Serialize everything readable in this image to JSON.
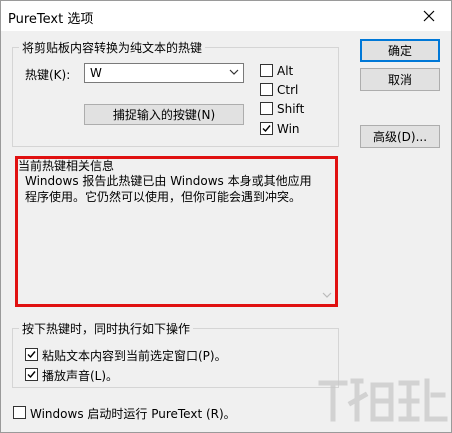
{
  "window": {
    "title": "PureText 选项"
  },
  "hotkey_group": {
    "title": "将剪贴板内容转换为纯文本的热键",
    "hotkey_label": "热键(K):",
    "hotkey_value": "W",
    "capture_button": "捕捉输入的按键(N)",
    "modifiers": [
      {
        "label": "Alt",
        "checked": false
      },
      {
        "label": "Ctrl",
        "checked": false
      },
      {
        "label": "Shift",
        "checked": false
      },
      {
        "label": "Win",
        "checked": true
      }
    ]
  },
  "buttons": {
    "ok": "确定",
    "cancel": "取消",
    "advanced": "高级(D)..."
  },
  "info_group": {
    "title": "当前热键相关信息",
    "text": "Windows 报告此热键已由 Windows 本身或其他应用程序使用。它仍然可以使用，但你可能会遇到冲突。"
  },
  "action_group": {
    "title": "按下热键时，同时执行如下操作",
    "paste": {
      "label": "粘贴文本内容到当前选定窗口(P)。",
      "checked": true
    },
    "sound": {
      "label": "播放声音(L)。",
      "checked": true
    }
  },
  "startup": {
    "label": "Windows 启动时运行 PureText (R)。",
    "checked": false
  },
  "colors": {
    "highlight": "#e01010",
    "accent": "#0078d7"
  }
}
